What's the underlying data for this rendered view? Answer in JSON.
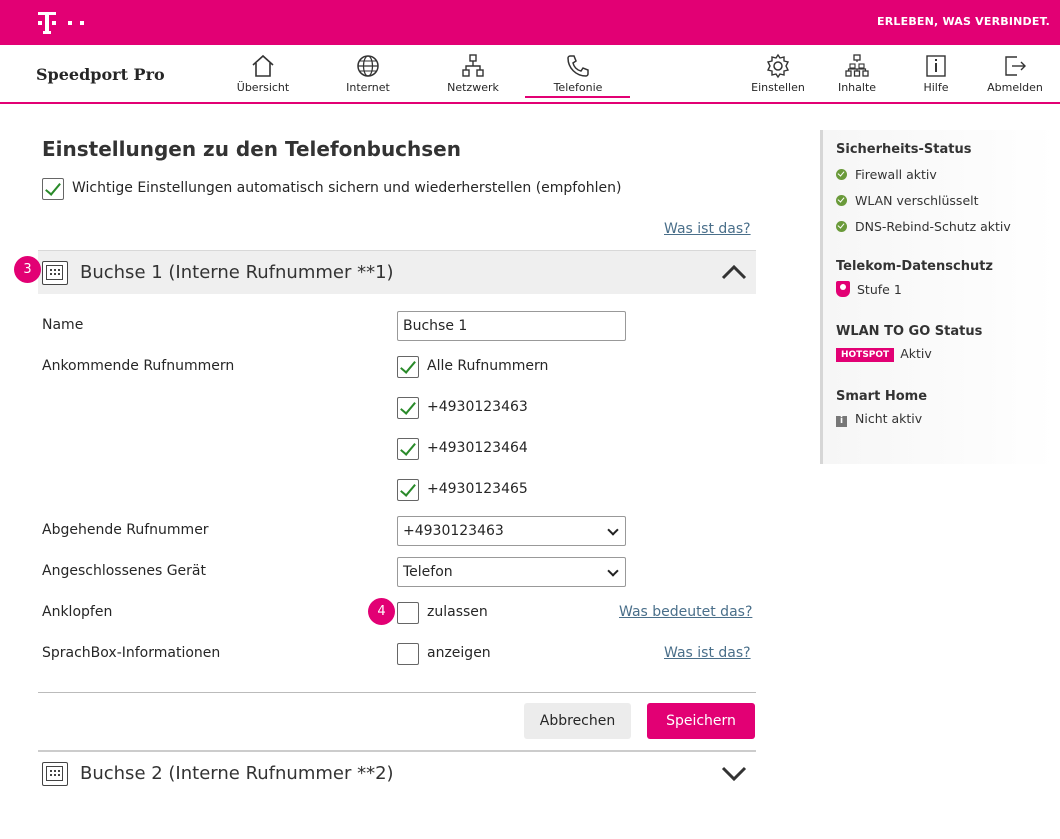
{
  "header": {
    "slogan": "ERLEBEN, WAS VERBINDET."
  },
  "nav": {
    "brand": "Speedport Pro",
    "items": [
      {
        "label": "Übersicht",
        "icon": "home-icon"
      },
      {
        "label": "Internet",
        "icon": "globe-icon"
      },
      {
        "label": "Netzwerk",
        "icon": "network-icon"
      },
      {
        "label": "Telefonie",
        "icon": "phone-icon",
        "active": true
      },
      {
        "label": "Einstellen",
        "icon": "gear-icon"
      },
      {
        "label": "Inhalte",
        "icon": "sitemap-icon"
      },
      {
        "label": "Hilfe",
        "icon": "info-icon"
      },
      {
        "label": "Abmelden",
        "icon": "logout-icon"
      }
    ]
  },
  "main": {
    "title": "Einstellungen zu den Telefonbuchsen",
    "autosave_label": "Wichtige Einstellungen automatisch sichern und wiederherstellen (empfohlen)",
    "autosave_checked": true,
    "was_ist_das_top": "Was ist das?",
    "section1": {
      "badge": "3",
      "title": "Buchse 1 (Interne Rufnummer **1)",
      "fields": {
        "name_label": "Name",
        "name_value": "Buchse 1",
        "incoming_label": "Ankommende Rufnummern",
        "incoming_options": [
          {
            "label": "Alle Rufnummern",
            "checked": true
          },
          {
            "label": "+4930123463",
            "checked": true
          },
          {
            "label": "+4930123464",
            "checked": true
          },
          {
            "label": "+4930123465",
            "checked": true
          }
        ],
        "outgoing_label": "Abgehende Rufnummer",
        "outgoing_value": "+4930123463",
        "device_label": "Angeschlossenes Gerät",
        "device_value": "Telefon",
        "anklopfen_label": "Anklopfen",
        "anklopfen_badge": "4",
        "anklopfen_option": "zulassen",
        "anklopfen_link": "Was bedeutet das?",
        "sprachbox_label": "SprachBox-Informationen",
        "sprachbox_option": "anzeigen",
        "sprachbox_link": "Was ist das?"
      },
      "cancel_label": "Abbrechen",
      "save_label": "Speichern"
    },
    "section2": {
      "title": "Buchse 2 (Interne Rufnummer **2)"
    }
  },
  "sidebar": {
    "security_title": "Sicherheits-Status",
    "security_items": [
      "Firewall aktiv",
      "WLAN verschlüsselt",
      "DNS-Rebind-Schutz aktiv"
    ],
    "privacy_title": "Telekom-Datenschutz",
    "privacy_value": "Stufe 1",
    "wlan_title": "WLAN TO GO Status",
    "hotspot_label": "HOTSPOT",
    "wlan_value": "Aktiv",
    "smarthome_title": "Smart Home",
    "smarthome_value": "Nicht aktiv"
  },
  "colors": {
    "brand": "#e20074",
    "check": "#2a8a2a",
    "status_ok": "#6a9a3a"
  }
}
